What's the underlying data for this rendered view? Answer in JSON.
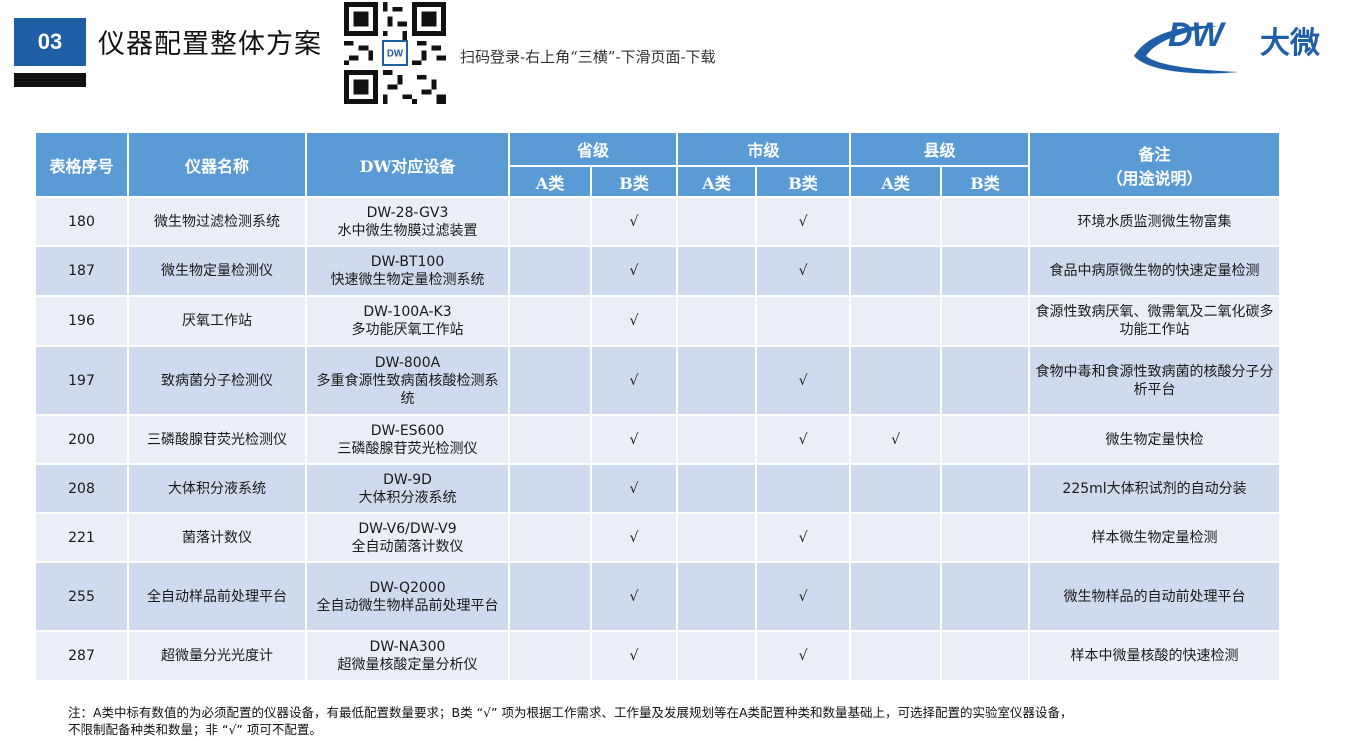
{
  "header": {
    "section_number": "03",
    "title": "仪器配置整体方案",
    "scan_instruction": "扫码登录-右上角“三横”-下滑页面-下载",
    "logo_text": "DW",
    "logo_cn": "大微",
    "brand_color": "#1f5fa8"
  },
  "table": {
    "headers": {
      "index": "表格序号",
      "name": "仪器名称",
      "dw_device": "DW对应设备",
      "province": "省级",
      "city": "市级",
      "county": "县级",
      "class_a": "A类",
      "class_b": "B类",
      "remark_line1": "备注",
      "remark_line2": "（用途说明）"
    },
    "rows": [
      {
        "index": "180",
        "name": "微生物过滤检测系统",
        "model": "DW-28-GV3",
        "device": "水中微生物膜过滤装置",
        "pa": "",
        "pb": "√",
        "ca": "",
        "cb": "√",
        "xa": "",
        "xb": "",
        "remark": "环境水质监测微生物富集"
      },
      {
        "index": "187",
        "name": "微生物定量检测仪",
        "model": "DW-BT100",
        "device": "快速微生物定量检测系统",
        "pa": "",
        "pb": "√",
        "ca": "",
        "cb": "√",
        "xa": "",
        "xb": "",
        "remark": "食品中病原微生物的快速定量检测"
      },
      {
        "index": "196",
        "name": "厌氧工作站",
        "model": "DW-100A-K3",
        "device": "多功能厌氧工作站",
        "pa": "",
        "pb": "√",
        "ca": "",
        "cb": "",
        "xa": "",
        "xb": "",
        "remark": "食源性致病厌氧、微需氧及二氧化碳多功能工作站"
      },
      {
        "index": "197",
        "name": "致病菌分子检测仪",
        "model": "DW-800A",
        "device": "多重食源性致病菌核酸检测系统",
        "pa": "",
        "pb": "√",
        "ca": "",
        "cb": "√",
        "xa": "",
        "xb": "",
        "remark": "食物中毒和食源性致病菌的核酸分子分析平台"
      },
      {
        "index": "200",
        "name": "三磷酸腺苷荧光检测仪",
        "model": "DW-ES600",
        "device": "三磷酸腺苷荧光检测仪",
        "pa": "",
        "pb": "√",
        "ca": "",
        "cb": "√",
        "xa": "√",
        "xb": "",
        "remark": "微生物定量快检"
      },
      {
        "index": "208",
        "name": "大体积分液系统",
        "model": "DW-9D",
        "device": "大体积分液系统",
        "pa": "",
        "pb": "√",
        "ca": "",
        "cb": "",
        "xa": "",
        "xb": "",
        "remark": "225ml大体积试剂的自动分装"
      },
      {
        "index": "221",
        "name": "菌落计数仪",
        "model": "DW-V6/DW-V9",
        "device": "全自动菌落计数仪",
        "pa": "",
        "pb": "√",
        "ca": "",
        "cb": "√",
        "xa": "",
        "xb": "",
        "remark": "样本微生物定量检测"
      },
      {
        "index": "255",
        "name": "全自动样品前处理平台",
        "model": "DW-Q2000",
        "device": "全自动微生物样品前处理平台",
        "pa": "",
        "pb": "√",
        "ca": "",
        "cb": "√",
        "xa": "",
        "xb": "",
        "remark": "微生物样品的自动前处理平台"
      },
      {
        "index": "287",
        "name": "超微量分光光度计",
        "model": "DW-NA300",
        "device": "超微量核酸定量分析仪",
        "pa": "",
        "pb": "√",
        "ca": "",
        "cb": "√",
        "xa": "",
        "xb": "",
        "remark": "样本中微量核酸的快速检测"
      }
    ]
  },
  "footnote": {
    "line1": "注：A类中标有数值的为必须配置的仪器设备，有最低配置数量要求；B类 “√” 项为根据工作需求、工作量及发展规划等在A类配置种类和数量基础上，可选择配置的实验室仪器设备，",
    "line2": "不限制配备种类和数量；非 “√” 项可不配置。"
  }
}
